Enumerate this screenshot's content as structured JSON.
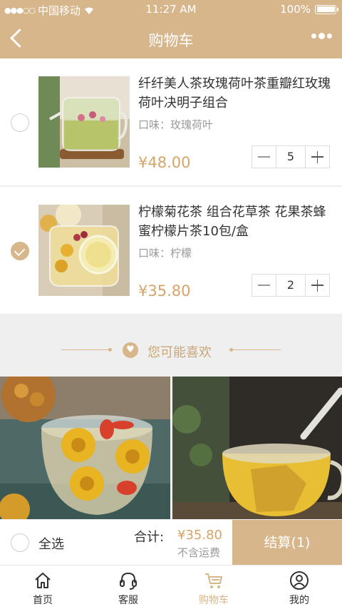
{
  "status_bar": {
    "carrier": "中国移动",
    "time": "11:27 AM",
    "battery": "100%"
  },
  "nav": {
    "title": "购物车"
  },
  "cart": {
    "items": [
      {
        "title": "纤纤美人茶玫瑰荷叶茶重瓣红玫瑰荷叶决明子组合",
        "flavor": "口味：玫瑰荷叶",
        "price": "¥48.00",
        "quantity": "5",
        "checked": false
      },
      {
        "title": "柠檬菊花茶 组合花草茶 花果茶蜂蜜柠檬片茶10包/盒",
        "flavor": "口味：柠檬",
        "price": "¥35.80",
        "quantity": "2",
        "checked": true
      }
    ]
  },
  "recommend": {
    "title": "您可能喜欢"
  },
  "checkout": {
    "select_all": "全选",
    "total_label": "合计:",
    "total_value": "¥35.80",
    "shipping_note": "不含运费",
    "button": "结算(1)"
  },
  "tabs": [
    {
      "label": "首页",
      "icon": "home-icon",
      "active": false
    },
    {
      "label": "客服",
      "icon": "headset-icon",
      "active": false
    },
    {
      "label": "购物车",
      "icon": "cart-icon",
      "active": true
    },
    {
      "label": "我的",
      "icon": "user-icon",
      "active": false
    }
  ],
  "colors": {
    "accent": "#d6b68a",
    "price": "#d6a468"
  }
}
